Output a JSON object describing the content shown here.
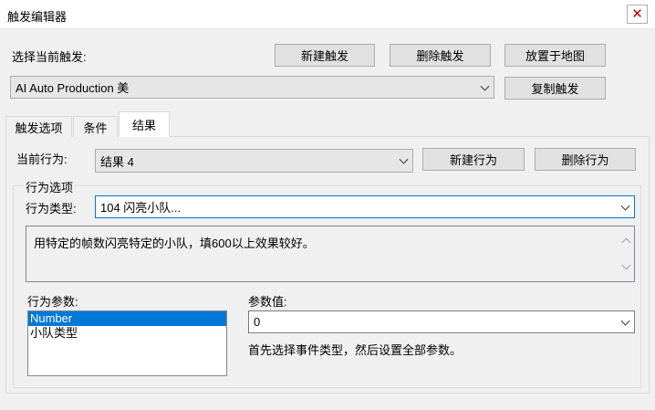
{
  "window": {
    "title": "触发编辑器",
    "close_glyph": "✕"
  },
  "trigger": {
    "select_label": "选择当前触发:",
    "current_value": "AI Auto Production 美",
    "new_button": "新建触发",
    "delete_button": "删除触发",
    "place_button": "放置于地图",
    "copy_button": "复制触发"
  },
  "tabs": [
    {
      "label": "触发选项"
    },
    {
      "label": "条件"
    },
    {
      "label": "结果"
    }
  ],
  "action": {
    "current_label": "当前行为:",
    "current_value": "结果 4",
    "new_button": "新建行为",
    "delete_button": "删除行为",
    "group_title": "行为选项",
    "type_label": "行为类型:",
    "type_value": "104 闪亮小队...",
    "description": "用特定的帧数闪亮特定的小队，填600以上效果较好。",
    "params_label": "行为参数:",
    "params": [
      "Number",
      "小队类型"
    ],
    "param_value_label": "参数值:",
    "param_value": "0",
    "hint": "首先选择事件类型，然后设置全部参数。"
  },
  "colors": {
    "selection": "#0078d7",
    "close_icon": "#c00000",
    "focus_border": "#0078d7"
  }
}
